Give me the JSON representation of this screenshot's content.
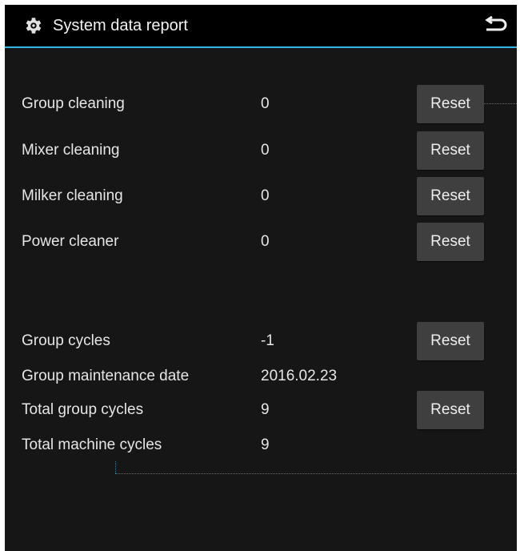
{
  "header": {
    "title": "System data report",
    "settings_icon": "gear-icon",
    "back_icon": "back-arrow-icon"
  },
  "colors": {
    "background": "#161616",
    "titlebar": "#000000",
    "accent": "#33b5e5",
    "button": "#3f3f3f",
    "text": "#e6e6e6"
  },
  "rows": [
    {
      "label": "Group cleaning",
      "value": "0",
      "button": "Reset"
    },
    {
      "label": "Mixer cleaning",
      "value": "0",
      "button": "Reset"
    },
    {
      "label": "Milker cleaning",
      "value": "0",
      "button": "Reset"
    },
    {
      "label": "Power cleaner",
      "value": "0",
      "button": "Reset"
    },
    {
      "label": "Group cycles",
      "value": "-1",
      "button": "Reset"
    },
    {
      "label": "Group maintenance date",
      "value": "2016.02.23"
    },
    {
      "label": "Total group cycles",
      "value": "9",
      "button": "Reset"
    },
    {
      "label": "Total machine cycles",
      "value": "9"
    }
  ]
}
